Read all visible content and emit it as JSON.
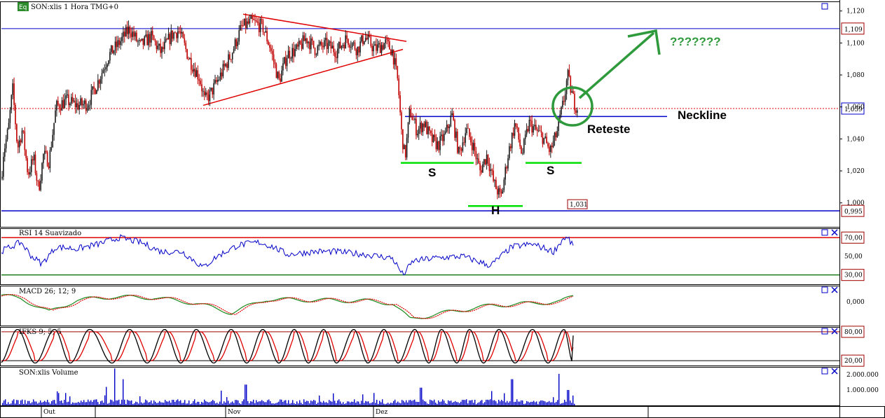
{
  "colors": {
    "candle_up": "#1a1a1a",
    "candle_down": "#c00000",
    "blue": "#0000c8",
    "red": "#e00000",
    "green": "#2e9a3c",
    "bright_green": "#00e000",
    "maroon": "#a00000"
  },
  "panels": {
    "price": {
      "title": "SON:xlis 1 Hora TMG+0",
      "badge": "Eq",
      "price_labels": {
        "resistance": "1,109",
        "last": "1,059",
        "support": "0,995",
        "low_marker": "1,031"
      },
      "annotations": {
        "s_left": "S",
        "head": "H",
        "s_right": "S",
        "neckline": "Neckline",
        "retest": "Reteste",
        "question": "???????"
      }
    },
    "rsi": {
      "title": "RSI 14 Suavizado",
      "label_high": "70,00",
      "label_low": "30,00"
    },
    "macd": {
      "title": "MACD 26; 12; 9"
    },
    "stoch": {
      "title": "IFKS 9; 5; 5",
      "label_high": "80,00",
      "label_low": "20,00"
    },
    "volume": {
      "title": "SON:xlis Volume"
    }
  },
  "chart_data": [
    {
      "type": "candlestick",
      "title": "SON:xlis 1 Hora TMG+0",
      "y_ticks": [
        "1,120",
        "1,100",
        "1,080",
        "1,060",
        "1,040",
        "1,020",
        "1,000"
      ],
      "ylim": [
        0.985,
        1.126
      ],
      "x_ticks": [
        "Out",
        "Nov",
        "Dez"
      ],
      "anchors": [
        [
          0,
          1.004
        ],
        [
          5,
          1.032
        ],
        [
          12,
          1.046
        ],
        [
          18,
          1.072
        ],
        [
          25,
          1.034
        ],
        [
          32,
          1.046
        ],
        [
          40,
          1.018
        ],
        [
          48,
          1.028
        ],
        [
          55,
          1.008
        ],
        [
          62,
          1.03
        ],
        [
          70,
          1.026
        ],
        [
          80,
          1.06
        ],
        [
          95,
          1.064
        ],
        [
          110,
          1.061
        ],
        [
          125,
          1.062
        ],
        [
          140,
          1.076
        ],
        [
          155,
          1.092
        ],
        [
          170,
          1.1
        ],
        [
          185,
          1.109
        ],
        [
          200,
          1.098
        ],
        [
          215,
          1.104
        ],
        [
          230,
          1.094
        ],
        [
          245,
          1.105
        ],
        [
          255,
          1.108
        ],
        [
          270,
          1.09
        ],
        [
          285,
          1.078
        ],
        [
          292,
          1.064
        ],
        [
          300,
          1.068
        ],
        [
          315,
          1.08
        ],
        [
          330,
          1.093
        ],
        [
          345,
          1.11
        ],
        [
          360,
          1.113
        ],
        [
          375,
          1.11
        ],
        [
          385,
          1.098
        ],
        [
          398,
          1.076
        ],
        [
          410,
          1.093
        ],
        [
          425,
          1.096
        ],
        [
          437,
          1.103
        ],
        [
          450,
          1.096
        ],
        [
          465,
          1.099
        ],
        [
          480,
          1.095
        ],
        [
          495,
          1.103
        ],
        [
          510,
          1.096
        ],
        [
          520,
          1.104
        ],
        [
          535,
          1.096
        ],
        [
          550,
          1.1
        ],
        [
          560,
          1.095
        ],
        [
          568,
          1.075
        ],
        [
          573,
          1.044
        ],
        [
          578,
          1.028
        ],
        [
          585,
          1.058
        ],
        [
          595,
          1.045
        ],
        [
          605,
          1.05
        ],
        [
          615,
          1.04
        ],
        [
          625,
          1.036
        ],
        [
          635,
          1.042
        ],
        [
          645,
          1.055
        ],
        [
          655,
          1.03
        ],
        [
          665,
          1.046
        ],
        [
          675,
          1.036
        ],
        [
          685,
          1.02
        ],
        [
          695,
          1.03
        ],
        [
          705,
          1.012
        ],
        [
          715,
          1.003
        ],
        [
          725,
          1.03
        ],
        [
          735,
          1.05
        ],
        [
          745,
          1.03
        ],
        [
          755,
          1.05
        ],
        [
          765,
          1.045
        ],
        [
          775,
          1.041
        ],
        [
          785,
          1.032
        ],
        [
          795,
          1.044
        ],
        [
          805,
          1.065
        ],
        [
          810,
          1.08
        ],
        [
          815,
          1.07
        ],
        [
          820,
          1.062
        ],
        [
          825,
          1.059
        ]
      ],
      "lines": {
        "resistance": 1.109,
        "support": 0.995,
        "dotted_level": 1.059,
        "neckline": 1.054,
        "shoulder_level": 1.025,
        "head_level": 0.998,
        "triangle_upper": [
          [
            347,
            1.118
          ],
          [
            580,
            1.101
          ]
        ],
        "triangle_lower": [
          [
            290,
            1.061
          ],
          [
            575,
            1.096
          ]
        ]
      }
    },
    {
      "type": "line",
      "title": "RSI 14 Suavizado",
      "levels": [
        70,
        30
      ],
      "y_ticks": [
        "70,00",
        "50,00",
        "30,00"
      ],
      "ylim": [
        20,
        80
      ],
      "values_anchors": [
        [
          0,
          55
        ],
        [
          15,
          60
        ],
        [
          30,
          65
        ],
        [
          45,
          50
        ],
        [
          60,
          42
        ],
        [
          80,
          60
        ],
        [
          110,
          58
        ],
        [
          140,
          63
        ],
        [
          170,
          70
        ],
        [
          200,
          65
        ],
        [
          230,
          55
        ],
        [
          260,
          55
        ],
        [
          290,
          38
        ],
        [
          310,
          50
        ],
        [
          340,
          62
        ],
        [
          370,
          65
        ],
        [
          390,
          60
        ],
        [
          410,
          52
        ],
        [
          450,
          55
        ],
        [
          480,
          55
        ],
        [
          520,
          52
        ],
        [
          560,
          48
        ],
        [
          575,
          30
        ],
        [
          590,
          45
        ],
        [
          620,
          48
        ],
        [
          660,
          50
        ],
        [
          700,
          40
        ],
        [
          730,
          60
        ],
        [
          760,
          63
        ],
        [
          790,
          55
        ],
        [
          805,
          70
        ],
        [
          812,
          68
        ],
        [
          818,
          60
        ]
      ]
    },
    {
      "type": "line",
      "title": "MACD 26; 12; 9",
      "series": [
        {
          "values_anchors": [
            [
              0,
              0.8
            ],
            [
              30,
              0.4
            ],
            [
              70,
              -1.3
            ],
            [
              110,
              0.2
            ],
            [
              160,
              0.6
            ],
            [
              220,
              0.5
            ],
            [
              280,
              -0.2
            ],
            [
              330,
              -1.4
            ],
            [
              380,
              0.3
            ],
            [
              440,
              0.2
            ],
            [
              520,
              0.1
            ],
            [
              560,
              -0.2
            ],
            [
              585,
              -2.2
            ],
            [
              640,
              -1.3
            ],
            [
              700,
              -0.5
            ],
            [
              760,
              -0.2
            ],
            [
              800,
              0.0
            ],
            [
              818,
              0.7
            ]
          ]
        }
      ],
      "y_ticks": [
        "0,000"
      ],
      "ylim": [
        -3,
        2
      ]
    },
    {
      "type": "line",
      "title": "IFKS 9; 5; 5",
      "levels": [
        80,
        20
      ],
      "y_ticks": [
        "80,00",
        "20,00"
      ],
      "ylim": [
        10,
        90
      ],
      "cycle_points": [
        0,
        25,
        50,
        78,
        100,
        128,
        160,
        185,
        210,
        235,
        258,
        280,
        305,
        330,
        352,
        375,
        398,
        420,
        440,
        462,
        480,
        505,
        525,
        548,
        568,
        592,
        612,
        630,
        652,
        670,
        690,
        712,
        735,
        760,
        782,
        805,
        818
      ]
    },
    {
      "type": "bar",
      "title": "SON:xlis Volume",
      "y_ticks": [
        "2.000.000",
        "1.000.000"
      ],
      "ylim": [
        0,
        2500000
      ],
      "spikes": [
        [
          150,
          1200000
        ],
        [
          163,
          2400000
        ],
        [
          175,
          1700000
        ],
        [
          350,
          1350000
        ],
        [
          600,
          1150000
        ],
        [
          730,
          1700000
        ],
        [
          797,
          2050000
        ],
        [
          810,
          1000000
        ]
      ]
    }
  ]
}
